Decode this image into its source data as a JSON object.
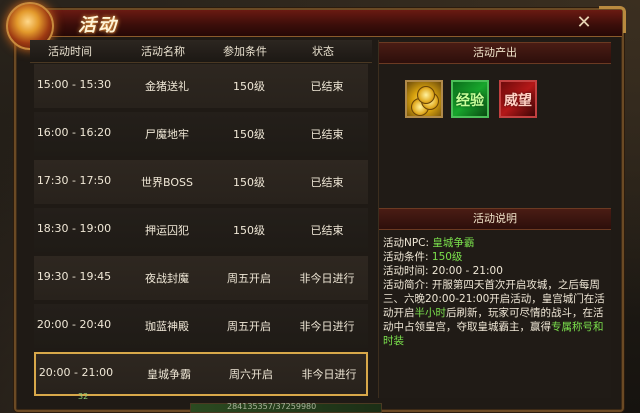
{
  "window": {
    "title": "活动"
  },
  "table": {
    "headers": [
      "活动时间",
      "活动名称",
      "参加条件",
      "状态"
    ],
    "rows": [
      {
        "time": "15:00 - 15:30",
        "name": "金猪送礼",
        "condition": "150级",
        "status": "已结束"
      },
      {
        "time": "16:00 - 16:20",
        "name": "尸魔地牢",
        "condition": "150级",
        "status": "已结束"
      },
      {
        "time": "17:30 - 17:50",
        "name": "世界BOSS",
        "condition": "150级",
        "status": "已结束"
      },
      {
        "time": "18:30 - 19:00",
        "name": "押运囚犯",
        "condition": "150级",
        "status": "已结束"
      },
      {
        "time": "19:30 - 19:45",
        "name": "夜战封魔",
        "condition": "周五开启",
        "status": "非今日进行"
      },
      {
        "time": "20:00 - 20:40",
        "name": "珈蓝神殿",
        "condition": "周五开启",
        "status": "非今日进行"
      },
      {
        "time": "20:00 - 21:00",
        "name": "皇城争霸",
        "condition": "周六开启",
        "status": "非今日进行"
      }
    ],
    "selected_index": 6
  },
  "rewards": {
    "header": "活动产出",
    "items": [
      {
        "label": "",
        "icon": "gold-coins-icon"
      },
      {
        "label": "经验",
        "icon": "experience-icon"
      },
      {
        "label": "威望",
        "icon": "prestige-icon"
      }
    ]
  },
  "description": {
    "header": "活动说明",
    "npc_label": "活动NPC:",
    "npc_value": "皇城争霸",
    "cond_label": "活动条件:",
    "cond_value": "150级",
    "time_label": "活动时间:",
    "time_value": "20:00 - 21:00",
    "intro_label": "活动简介:",
    "intro_text_1": "开服第四天首次开启攻城，之后每周三、六晚20:00-21:00开启活动，皇宫城门在活动开启",
    "intro_highlight_1": "半小时",
    "intro_text_2": "后刷新，玩家可尽情的战斗，在活动中占领皇宫，夺取皇城霸主，赢得",
    "intro_highlight_2": "专属称号和时装"
  },
  "bottom": {
    "level_number": "32",
    "bar_text": "284135357/37259980"
  },
  "colors": {
    "highlight_green": "#7ae04c",
    "selected_border": "#d8a84a",
    "title_red": "#6a1a12"
  }
}
